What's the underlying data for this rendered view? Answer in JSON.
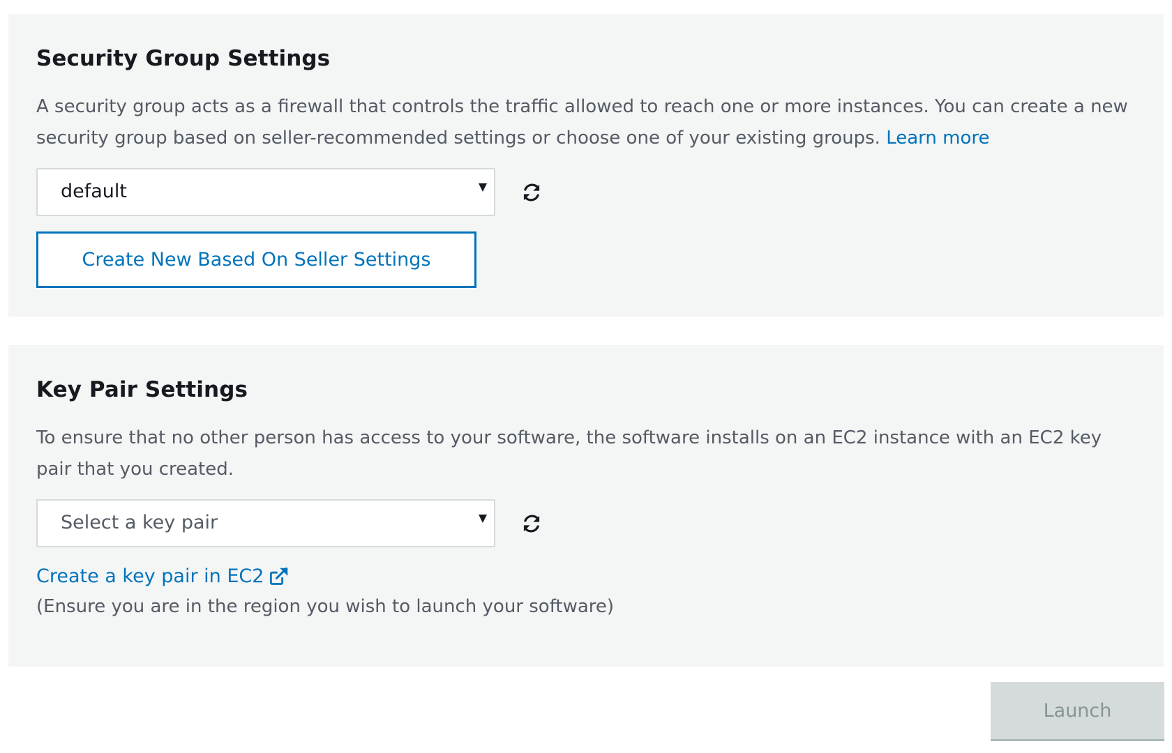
{
  "security_group": {
    "title": "Security Group Settings",
    "description": "A security group acts as a firewall that controls the traffic allowed to reach one or more instances. You can create a new security group based on seller-recommended settings or choose one of your existing groups.",
    "learn_more_label": "Learn more",
    "select_value": "default",
    "refresh_icon": "refresh-icon",
    "create_button_label": "Create New Based On Seller Settings"
  },
  "key_pair": {
    "title": "Key Pair Settings",
    "description": "To ensure that no other person has access to your software, the software installs on an EC2 instance with an EC2 key pair that you created.",
    "select_placeholder": "Select a key pair",
    "refresh_icon": "refresh-icon",
    "create_link_label": "Create a key pair in EC2",
    "external_icon": "external-link-icon",
    "region_note": "(Ensure you are in the region you wish to launch your software)"
  },
  "footer": {
    "launch_label": "Launch",
    "launch_disabled": true
  },
  "colors": {
    "panel_background": "#f4f5f5",
    "link": "#0073bb",
    "title": "#16191f",
    "body_text": "#545b64",
    "disabled_button_bg": "#d5dbdb",
    "disabled_button_text": "#879596"
  }
}
